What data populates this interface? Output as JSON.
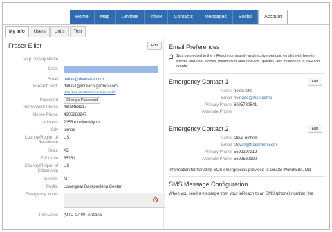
{
  "topnav": {
    "tabs": [
      {
        "label": "Home",
        "active": false
      },
      {
        "label": "Map",
        "active": false
      },
      {
        "label": "Devices",
        "active": false
      },
      {
        "label": "Inbox",
        "active": false
      },
      {
        "label": "Contacts",
        "active": false
      },
      {
        "label": "Messages",
        "active": false
      },
      {
        "label": "Social",
        "active": false
      },
      {
        "label": "Account",
        "active": true
      }
    ]
  },
  "subtabs": [
    {
      "label": "My Info",
      "active": true
    },
    {
      "label": "Users",
      "active": false
    },
    {
      "label": "Units",
      "active": false
    },
    {
      "label": "Test",
      "active": false
    }
  ],
  "profile": {
    "name": "Fraser Elliot",
    "edit_label": "Edit",
    "fields": {
      "map_display_name": {
        "label": "Map Display Name",
        "value": ""
      },
      "color": {
        "label": "Color",
        "value": "#9bb9e6"
      },
      "email": {
        "label": "Email",
        "value": "dallas@dialowite.com"
      },
      "inreach_addr": {
        "label": "inReach Addr",
        "value": "dallas1@inreach.garmin.com",
        "help_link": "How does an inReach address work?"
      },
      "password": {
        "label": "Password",
        "button": "Change Password"
      },
      "home_phone": {
        "label": "Home/Work Phone",
        "value": "4803458917"
      },
      "mobile_phone": {
        "label": "Mobile Phone",
        "value": "4805888247"
      },
      "address": {
        "label": "Address",
        "value": "2155 e university dr,"
      },
      "city": {
        "label": "City",
        "value": "tempe"
      },
      "country": {
        "label": "Country/Region of Residence",
        "value": "US"
      },
      "state": {
        "label": "State",
        "value": "AZ"
      },
      "zip": {
        "label": "ZIP Code",
        "value": "85281"
      },
      "citizenship": {
        "label": "Country/Region of Citizenship",
        "value": "US"
      },
      "gender": {
        "label": "Gender",
        "value": "M"
      },
      "profile": {
        "label": "Profile",
        "value": "Lowergear Backpacking Center"
      },
      "emergency_notes": {
        "label": "Emergency Notes",
        "value": ""
      },
      "time_zone": {
        "label": "Time Zone",
        "value": "(UTC-07:00) Arizona"
      }
    }
  },
  "email_prefs": {
    "title": "Email Preferences",
    "checkbox_text": "Stay connected to the inReach community and receive periodic emails with how-to articles and user stories, information about device updates, and invitations to inReach events."
  },
  "ec1": {
    "title": "Emergency Contact 1",
    "edit_label": "Edit",
    "name_label": "Name",
    "name": "helen hilts",
    "email_label": "Email",
    "email": "helndee@msn.como",
    "primary_label": "Primary Phone",
    "primary": "6025780541",
    "alt_label": "Alternate Phone",
    "alt": ""
  },
  "ec2": {
    "title": "Emergency Contact 2",
    "edit_label": "Edit",
    "name_label": "Name",
    "name": "steve nichols",
    "email_label": "Email",
    "email": "steven@fraserfirm.com",
    "primary_label": "Primary Phone",
    "primary": "5592297219",
    "alt_label": "Alternate Phone",
    "alt": "5592530999"
  },
  "sos_info": "Information for handling SOS emergencies provided to GEOS Worldwide, Ltd.",
  "sms": {
    "title": "SMS Message Configuration",
    "text": "When you send a message from your inReach to an SMS (phone) number, the"
  }
}
